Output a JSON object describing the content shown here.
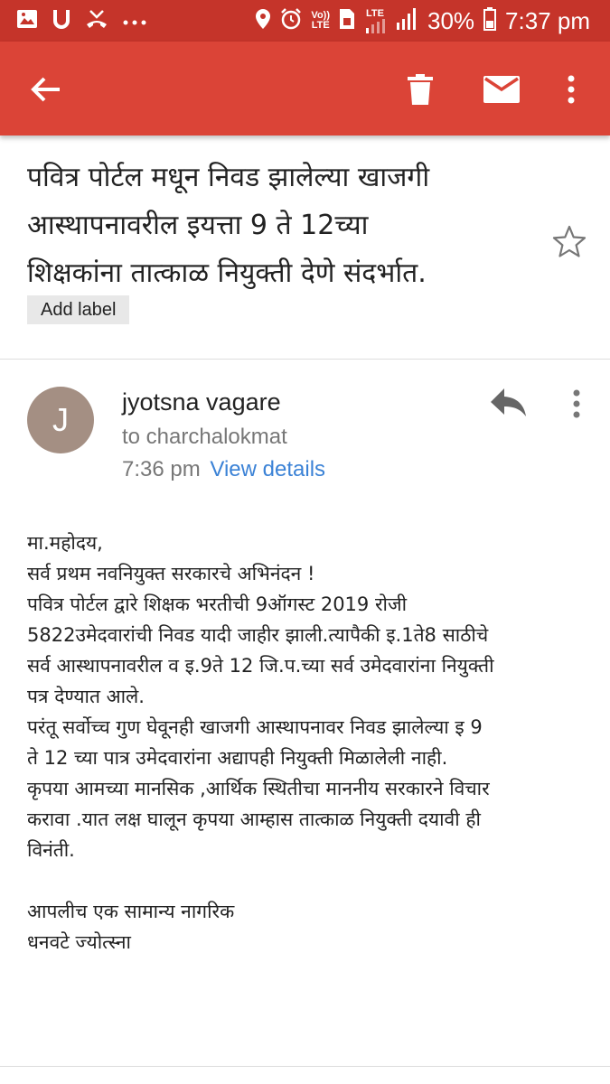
{
  "status_bar": {
    "volte_line1": "Vo))",
    "volte_line2": "LTE",
    "lte": "LTE",
    "battery": "30%",
    "time": "7:37 pm"
  },
  "toolbar": {
    "icons": [
      "back-arrow-icon",
      "delete-icon",
      "mail-icon",
      "more-vert-icon"
    ],
    "color": "#db4437",
    "status_color": "#c5342a"
  },
  "email": {
    "subject_lines": [
      "पवित्र पोर्टल मधून निवड झालेल्या खाजगी",
      "आस्थापनावरील इयत्ता 9 ते 12च्या",
      "शिक्षकांना तात्काळ नियुक्ती देणे संदर्भात."
    ],
    "add_label": "Add label",
    "sender": {
      "initial": "J",
      "name": "jyotsna vagare",
      "to": "to charchalokmat",
      "time": "7:36 pm",
      "view_details": "View details",
      "avatar_color": "#a48f83"
    },
    "body_lines": [
      "मा.महोदय,",
      "सर्व प्रथम नवनियुक्त सरकारचे अभिनंदन !",
      "पवित्र पोर्टल द्वारे शिक्षक भरतीची 9ऑगस्ट 2019  रोजी",
      "5822उमेदवारांची निवड यादी जाहीर झाली.त्यापैकी इ.1ते8 साठीचे",
      "सर्व आस्थापनावरील व इ.9ते 12 जि.प.च्या सर्व उमेदवारांना नियुक्ती",
      "पत्र देण्यात आले.",
      "परंतू सर्वोच्च गुण घेवूनही खाजगी आस्थापनावर निवड झालेल्या इ 9",
      "ते 12 च्या पात्र उमेदवारांना अद्यापही नियुक्ती मिळालेली नाही.",
      "कृपया आमच्या मानसिक ,आर्थिक स्थितीचा माननीय सरकारने विचार",
      "करावा .यात लक्ष घालून कृपया आम्हास तात्काळ नियुक्ती दयावी ही",
      "विनंती.",
      "",
      "आपलीच एक सामान्य नागरिक",
      "धनवटे ज्योत्स्ना"
    ]
  }
}
